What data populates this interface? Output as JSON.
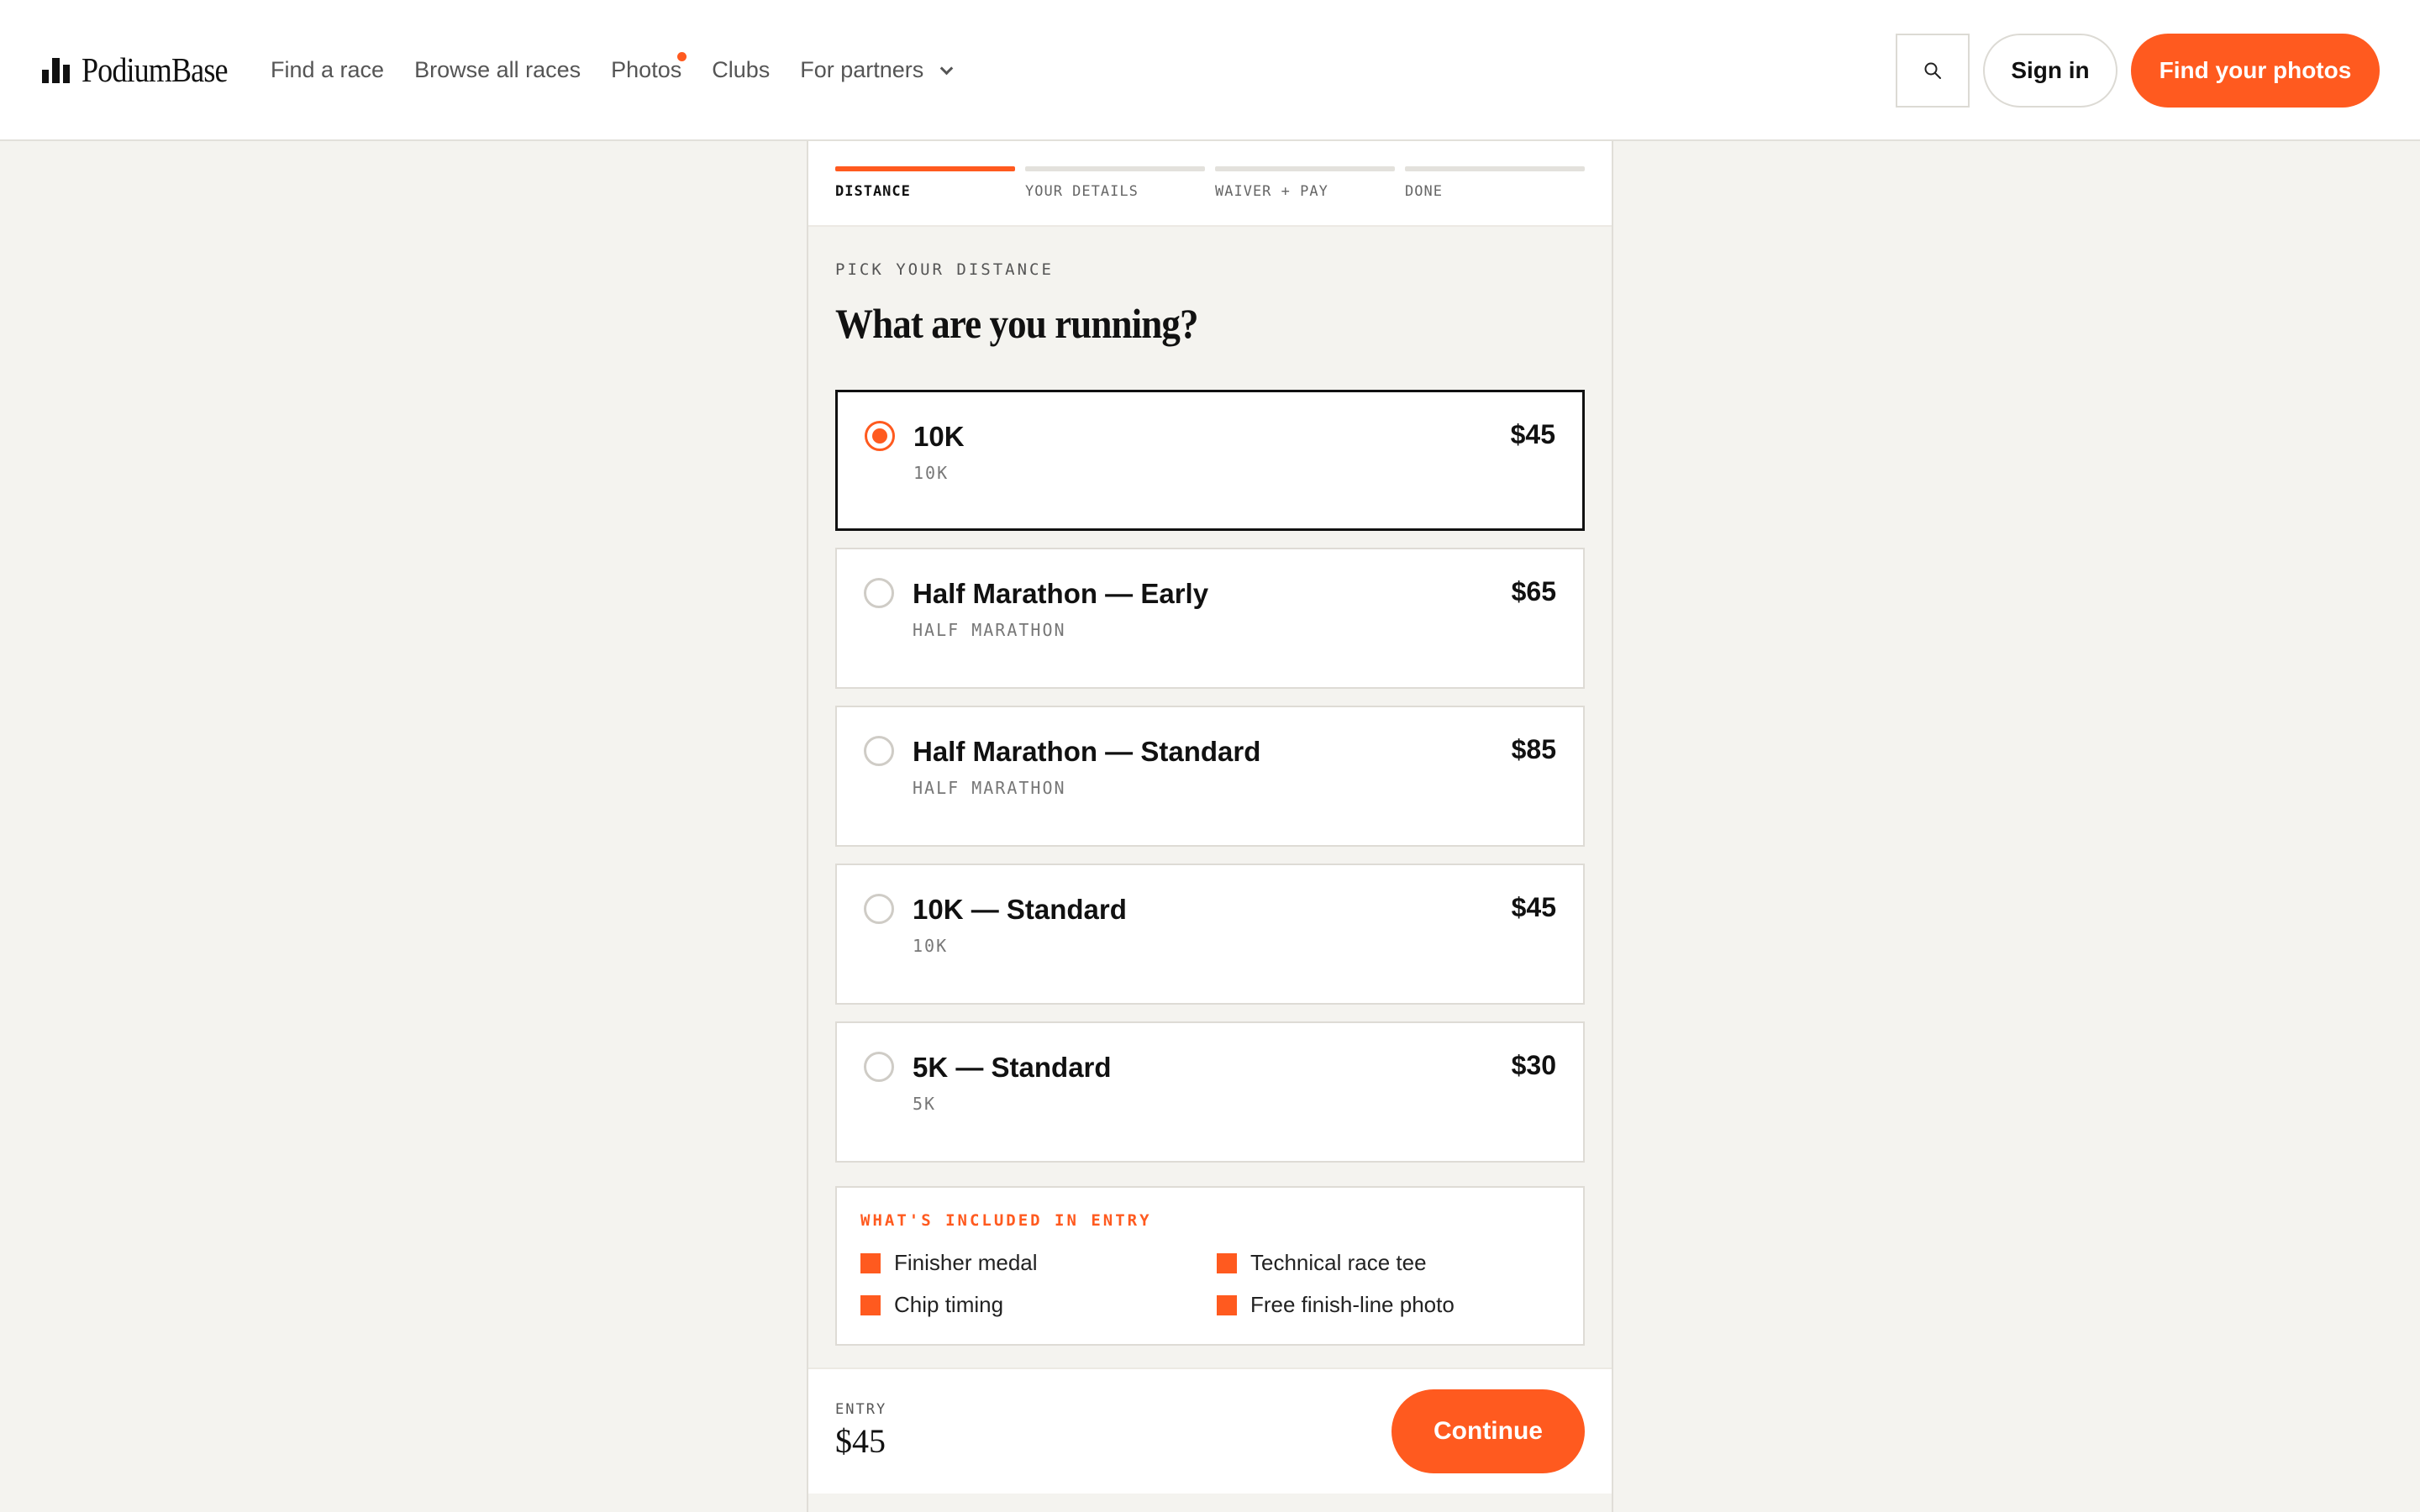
{
  "brand": {
    "name": "PodiumBase"
  },
  "nav": {
    "items": [
      {
        "label": "Find a race"
      },
      {
        "label": "Browse all races"
      },
      {
        "label": "Photos",
        "has_notification_dot": true
      },
      {
        "label": "Clubs"
      },
      {
        "label": "For partners",
        "has_dropdown": true
      }
    ]
  },
  "header_actions": {
    "search_icon": "search-icon",
    "signin_label": "Sign in",
    "cta_label": "Find your photos"
  },
  "steps": [
    {
      "label": "DISTANCE",
      "active": true
    },
    {
      "label": "YOUR DETAILS",
      "active": false
    },
    {
      "label": "WAIVER + PAY",
      "active": false
    },
    {
      "label": "DONE",
      "active": false
    }
  ],
  "distance": {
    "eyebrow": "PICK YOUR DISTANCE",
    "title": "What are you running?",
    "options": [
      {
        "name": "10K",
        "category": "10K",
        "price": "$45",
        "selected": true
      },
      {
        "name": "Half Marathon — Early",
        "category": "HALF MARATHON",
        "price": "$65",
        "selected": false
      },
      {
        "name": "Half Marathon — Standard",
        "category": "HALF MARATHON",
        "price": "$85",
        "selected": false
      },
      {
        "name": "10K — Standard",
        "category": "10K",
        "price": "$45",
        "selected": false
      },
      {
        "name": "5K — Standard",
        "category": "5K",
        "price": "$30",
        "selected": false
      }
    ]
  },
  "included": {
    "title": "WHAT'S INCLUDED IN ENTRY",
    "items": [
      "Finisher medal",
      "Technical race tee",
      "Chip timing",
      "Free finish-line photo"
    ]
  },
  "footer": {
    "entry_label": "ENTRY",
    "entry_value": "$45",
    "continue_label": "Continue"
  },
  "colors": {
    "accent": "#ff5a1f",
    "background": "#f4f3ef",
    "text": "#111111"
  }
}
